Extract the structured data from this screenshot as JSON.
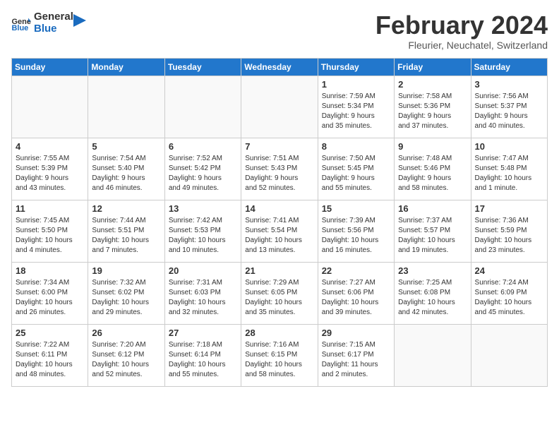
{
  "header": {
    "logo_general": "General",
    "logo_blue": "Blue",
    "month_title": "February 2024",
    "location": "Fleurier, Neuchatel, Switzerland"
  },
  "weekdays": [
    "Sunday",
    "Monday",
    "Tuesday",
    "Wednesday",
    "Thursday",
    "Friday",
    "Saturday"
  ],
  "weeks": [
    [
      {
        "num": "",
        "info": ""
      },
      {
        "num": "",
        "info": ""
      },
      {
        "num": "",
        "info": ""
      },
      {
        "num": "",
        "info": ""
      },
      {
        "num": "1",
        "info": "Sunrise: 7:59 AM\nSunset: 5:34 PM\nDaylight: 9 hours\nand 35 minutes."
      },
      {
        "num": "2",
        "info": "Sunrise: 7:58 AM\nSunset: 5:36 PM\nDaylight: 9 hours\nand 37 minutes."
      },
      {
        "num": "3",
        "info": "Sunrise: 7:56 AM\nSunset: 5:37 PM\nDaylight: 9 hours\nand 40 minutes."
      }
    ],
    [
      {
        "num": "4",
        "info": "Sunrise: 7:55 AM\nSunset: 5:39 PM\nDaylight: 9 hours\nand 43 minutes."
      },
      {
        "num": "5",
        "info": "Sunrise: 7:54 AM\nSunset: 5:40 PM\nDaylight: 9 hours\nand 46 minutes."
      },
      {
        "num": "6",
        "info": "Sunrise: 7:52 AM\nSunset: 5:42 PM\nDaylight: 9 hours\nand 49 minutes."
      },
      {
        "num": "7",
        "info": "Sunrise: 7:51 AM\nSunset: 5:43 PM\nDaylight: 9 hours\nand 52 minutes."
      },
      {
        "num": "8",
        "info": "Sunrise: 7:50 AM\nSunset: 5:45 PM\nDaylight: 9 hours\nand 55 minutes."
      },
      {
        "num": "9",
        "info": "Sunrise: 7:48 AM\nSunset: 5:46 PM\nDaylight: 9 hours\nand 58 minutes."
      },
      {
        "num": "10",
        "info": "Sunrise: 7:47 AM\nSunset: 5:48 PM\nDaylight: 10 hours\nand 1 minute."
      }
    ],
    [
      {
        "num": "11",
        "info": "Sunrise: 7:45 AM\nSunset: 5:50 PM\nDaylight: 10 hours\nand 4 minutes."
      },
      {
        "num": "12",
        "info": "Sunrise: 7:44 AM\nSunset: 5:51 PM\nDaylight: 10 hours\nand 7 minutes."
      },
      {
        "num": "13",
        "info": "Sunrise: 7:42 AM\nSunset: 5:53 PM\nDaylight: 10 hours\nand 10 minutes."
      },
      {
        "num": "14",
        "info": "Sunrise: 7:41 AM\nSunset: 5:54 PM\nDaylight: 10 hours\nand 13 minutes."
      },
      {
        "num": "15",
        "info": "Sunrise: 7:39 AM\nSunset: 5:56 PM\nDaylight: 10 hours\nand 16 minutes."
      },
      {
        "num": "16",
        "info": "Sunrise: 7:37 AM\nSunset: 5:57 PM\nDaylight: 10 hours\nand 19 minutes."
      },
      {
        "num": "17",
        "info": "Sunrise: 7:36 AM\nSunset: 5:59 PM\nDaylight: 10 hours\nand 23 minutes."
      }
    ],
    [
      {
        "num": "18",
        "info": "Sunrise: 7:34 AM\nSunset: 6:00 PM\nDaylight: 10 hours\nand 26 minutes."
      },
      {
        "num": "19",
        "info": "Sunrise: 7:32 AM\nSunset: 6:02 PM\nDaylight: 10 hours\nand 29 minutes."
      },
      {
        "num": "20",
        "info": "Sunrise: 7:31 AM\nSunset: 6:03 PM\nDaylight: 10 hours\nand 32 minutes."
      },
      {
        "num": "21",
        "info": "Sunrise: 7:29 AM\nSunset: 6:05 PM\nDaylight: 10 hours\nand 35 minutes."
      },
      {
        "num": "22",
        "info": "Sunrise: 7:27 AM\nSunset: 6:06 PM\nDaylight: 10 hours\nand 39 minutes."
      },
      {
        "num": "23",
        "info": "Sunrise: 7:25 AM\nSunset: 6:08 PM\nDaylight: 10 hours\nand 42 minutes."
      },
      {
        "num": "24",
        "info": "Sunrise: 7:24 AM\nSunset: 6:09 PM\nDaylight: 10 hours\nand 45 minutes."
      }
    ],
    [
      {
        "num": "25",
        "info": "Sunrise: 7:22 AM\nSunset: 6:11 PM\nDaylight: 10 hours\nand 48 minutes."
      },
      {
        "num": "26",
        "info": "Sunrise: 7:20 AM\nSunset: 6:12 PM\nDaylight: 10 hours\nand 52 minutes."
      },
      {
        "num": "27",
        "info": "Sunrise: 7:18 AM\nSunset: 6:14 PM\nDaylight: 10 hours\nand 55 minutes."
      },
      {
        "num": "28",
        "info": "Sunrise: 7:16 AM\nSunset: 6:15 PM\nDaylight: 10 hours\nand 58 minutes."
      },
      {
        "num": "29",
        "info": "Sunrise: 7:15 AM\nSunset: 6:17 PM\nDaylight: 11 hours\nand 2 minutes."
      },
      {
        "num": "",
        "info": ""
      },
      {
        "num": "",
        "info": ""
      }
    ]
  ]
}
